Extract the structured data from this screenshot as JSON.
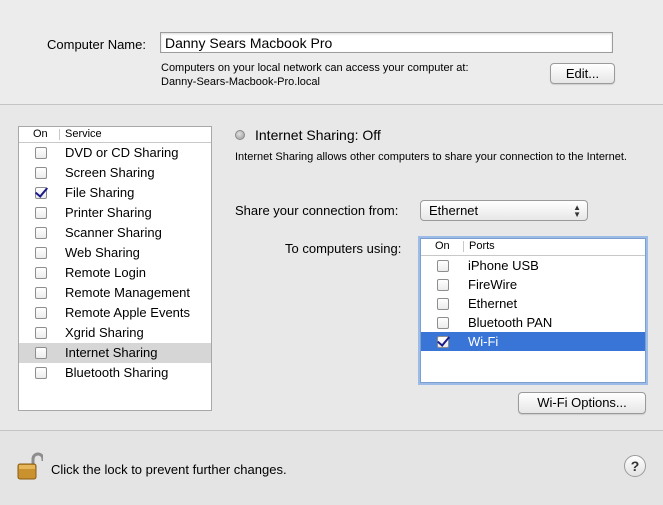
{
  "computer_name": {
    "label": "Computer Name:",
    "value": "Danny Sears Macbook Pro",
    "address_line1": "Computers on your local network can access your computer at:",
    "address_line2": "Danny-Sears-Macbook-Pro.local",
    "edit_label": "Edit..."
  },
  "services": {
    "header_on": "On",
    "header_service": "Service",
    "items": [
      {
        "label": "DVD or CD Sharing",
        "checked": false
      },
      {
        "label": "Screen Sharing",
        "checked": false
      },
      {
        "label": "File Sharing",
        "checked": true
      },
      {
        "label": "Printer Sharing",
        "checked": false
      },
      {
        "label": "Scanner Sharing",
        "checked": false
      },
      {
        "label": "Web Sharing",
        "checked": false
      },
      {
        "label": "Remote Login",
        "checked": false
      },
      {
        "label": "Remote Management",
        "checked": false
      },
      {
        "label": "Remote Apple Events",
        "checked": false
      },
      {
        "label": "Xgrid Sharing",
        "checked": false
      },
      {
        "label": "Internet Sharing",
        "checked": false,
        "selected": true
      },
      {
        "label": "Bluetooth Sharing",
        "checked": false
      }
    ]
  },
  "detail": {
    "status": "Internet Sharing: Off",
    "description": "Internet Sharing allows other computers to share your connection to the Internet.",
    "share_from_label": "Share your connection from:",
    "share_from_value": "Ethernet",
    "to_computers_label": "To computers using:",
    "ports_header_on": "On",
    "ports_header_ports": "Ports",
    "ports": [
      {
        "label": "iPhone USB",
        "checked": false
      },
      {
        "label": "FireWire",
        "checked": false
      },
      {
        "label": "Ethernet",
        "checked": false
      },
      {
        "label": "Bluetooth PAN",
        "checked": false
      },
      {
        "label": "Wi-Fi",
        "checked": true,
        "selected": true
      }
    ],
    "wifi_options_label": "Wi-Fi Options..."
  },
  "footer": {
    "lock_text": "Click the lock to prevent further changes.",
    "help_label": "?"
  }
}
